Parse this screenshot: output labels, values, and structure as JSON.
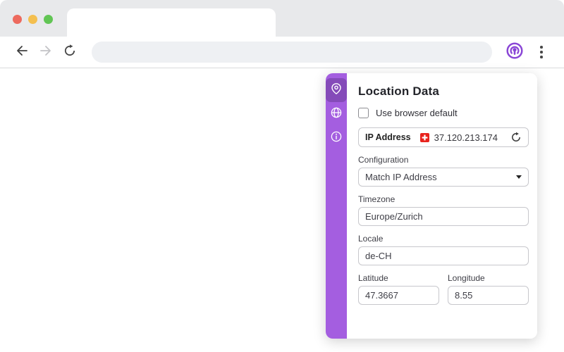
{
  "browser": {
    "traffic_lights": [
      "close",
      "minimize",
      "maximize"
    ],
    "tab_title": "",
    "url_value": "",
    "url_placeholder": ""
  },
  "panel": {
    "title": "Location Data",
    "default_checkbox": {
      "label": "Use browser default",
      "checked": false
    },
    "ip_row": {
      "label": "IP Address",
      "flag_country": "Switzerland",
      "value": "37.120.213.174"
    },
    "configuration": {
      "label": "Configuration",
      "value": "Match IP Address"
    },
    "timezone": {
      "label": "Timezone",
      "value": "Europe/Zurich"
    },
    "locale": {
      "label": "Locale",
      "value": "de-CH"
    },
    "latitude": {
      "label": "Latitude",
      "value": "47.3667"
    },
    "longitude": {
      "label": "Longitude",
      "value": "8.55"
    },
    "sidebar_icons": [
      "location-pin",
      "globe",
      "info"
    ]
  },
  "colors": {
    "sidebar_purple": "#a45ee0",
    "extension_purple": "#8a46d6",
    "flag_red": "#e8231d",
    "chrome_grey": "#e8e9eb",
    "url_pill_grey": "#eef0f3"
  }
}
